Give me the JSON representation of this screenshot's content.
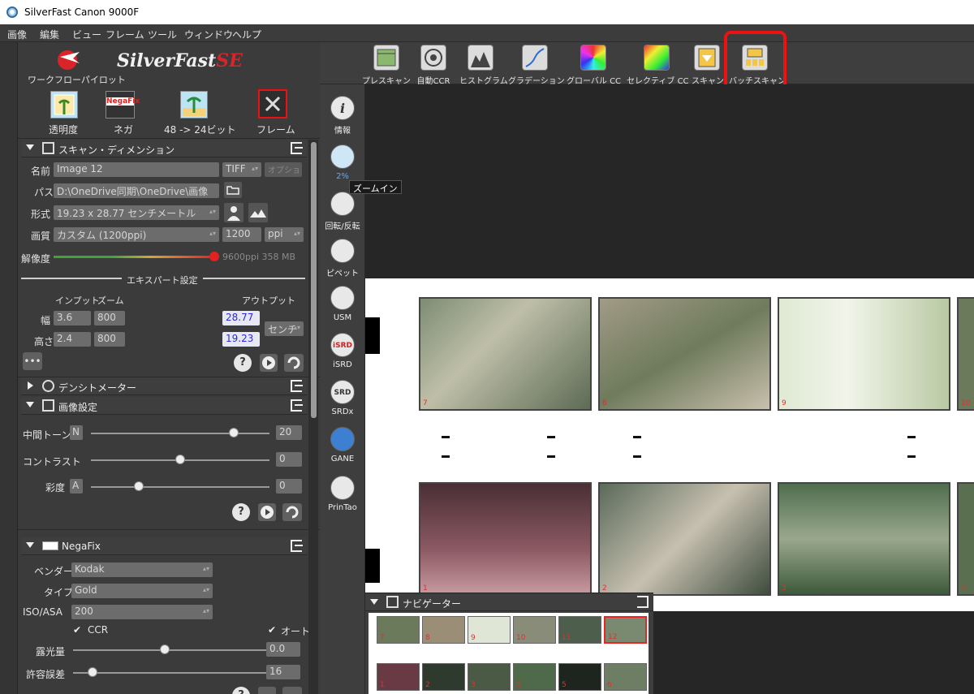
{
  "window": {
    "title": "SilverFast  Canon 9000F",
    "icon": "silverfast-app-icon"
  },
  "menubar": {
    "items": [
      "画像",
      "編集",
      "ビュー",
      "フレーム",
      "ツール",
      "ウィンドウ",
      "ヘルプ"
    ]
  },
  "workflow": {
    "logo_label": "SilverFast",
    "logo_suffix": "SE",
    "pilot_label": "ワークフローパイロット"
  },
  "modes": [
    {
      "label": "透明度",
      "icon": "transparency-icon"
    },
    {
      "label": "ネガ",
      "icon": "negafix-icon",
      "badge": "NegaFix"
    },
    {
      "label": "48 -> 24ビット",
      "icon": "bitdepth-icon"
    },
    {
      "label": "フレーム",
      "icon": "frame-tools-icon"
    }
  ],
  "scan_dimension": {
    "title": "スキャン・ディメンション",
    "name_label": "名前",
    "name_value": "Image 12",
    "format_value": "TIFF",
    "option_label": "オプション",
    "path_label": "パス",
    "path_value": "D:\\OneDrive同期\\OneDrive\\画像",
    "size_label": "形式",
    "size_value": "19.23 x 28.77 センチメートル",
    "quality_label": "画質",
    "quality_value": "カスタム (1200ppi)",
    "ppi_value": "1200",
    "ppi_unit": "ppi",
    "resolution_label": "解像度",
    "resolution_info": "9600ppi 358 MB",
    "expert_label": "エキスパート設定",
    "input_label": "インプット",
    "zoom_label": "ズーム",
    "output_label": "アウトプット",
    "width_label": "幅",
    "width_input": "3.6",
    "width_zoom": "800",
    "width_output": "28.77",
    "height_label": "高さ",
    "height_input": "2.4",
    "height_zoom": "800",
    "height_output": "19.23",
    "unit_value": "センチ",
    "more_label": "•••"
  },
  "densitometer": {
    "title": "デンシトメーター"
  },
  "image_settings": {
    "title": "画像設定",
    "midtone_label": "中間トーン",
    "midtone_mode": "N",
    "midtone_value": "20",
    "midtone_level": 0.8,
    "contrast_label": "コントラスト",
    "contrast_value": "0",
    "contrast_level": 0.5,
    "saturation_label": "彩度",
    "saturation_mode": "A",
    "saturation_value": "0",
    "saturation_level": 0.27
  },
  "negafix": {
    "title": "NegaFix",
    "vendor_label": "ベンダー",
    "vendor_value": "Kodak",
    "type_label": "タイプ",
    "type_value": "Gold",
    "iso_label": "ISO/ASA",
    "iso_value": "200",
    "ccr_label": "CCR",
    "auto_label": "オート",
    "exposure_label": "露光量",
    "exposure_value": "0.0",
    "exposure_level": 0.47,
    "tolerance_label": "許容誤差",
    "tolerance_value": "16",
    "tolerance_level": 0.1
  },
  "toolbar": {
    "items": [
      {
        "label": "プレスキャン",
        "icon": "prescan-icon"
      },
      {
        "label": "自動CCR",
        "icon": "auto-ccr-icon"
      },
      {
        "label": "ヒストグラム",
        "icon": "histogram-icon"
      },
      {
        "label": "グラデーション",
        "icon": "gradation-icon"
      },
      {
        "label": "グローバル CC",
        "icon": "global-cc-icon"
      },
      {
        "label": "セレクティブ CC",
        "icon": "selective-cc-icon"
      },
      {
        "label": "スキャン",
        "icon": "scan-icon"
      },
      {
        "label": "バッチスキャン",
        "icon": "batch-scan-icon"
      }
    ]
  },
  "vtools": [
    {
      "label": "情報",
      "glyph": "i",
      "icon": "info-icon"
    },
    {
      "label": "2%",
      "glyph": "",
      "icon": "zoom-icon"
    },
    {
      "label": "回転/反転",
      "glyph": "",
      "icon": "rotate-flip-icon"
    },
    {
      "label": "ピペット",
      "glyph": "",
      "icon": "pipette-icon"
    },
    {
      "label": "USM",
      "glyph": "",
      "icon": "usm-icon"
    },
    {
      "label": "iSRD",
      "glyph": "iSRD",
      "icon": "isrd-icon"
    },
    {
      "label": "SRDx",
      "glyph": "SRD",
      "icon": "srdx-icon"
    },
    {
      "label": "GANE",
      "glyph": "",
      "icon": "gane-icon"
    },
    {
      "label": "PrinTao",
      "glyph": "",
      "icon": "printao-icon"
    }
  ],
  "tooltip": {
    "text": "ズームイン"
  },
  "film": {
    "top_frames": [
      "7",
      "8",
      "9",
      "10"
    ],
    "bottom_frames": [
      "1",
      "2",
      "3",
      "4"
    ]
  },
  "navigator": {
    "title": "ナビゲーター",
    "top_thumbs": [
      "7",
      "8",
      "9",
      "10",
      "11",
      "12"
    ],
    "bottom_thumbs": [
      "1",
      "2",
      "3",
      "4",
      "5",
      "6"
    ]
  },
  "colors": {
    "accent_red": "#e11111",
    "output_blue": "#2a2adc",
    "slider_red": "#e22222",
    "slider_green": "#3fa33a"
  }
}
